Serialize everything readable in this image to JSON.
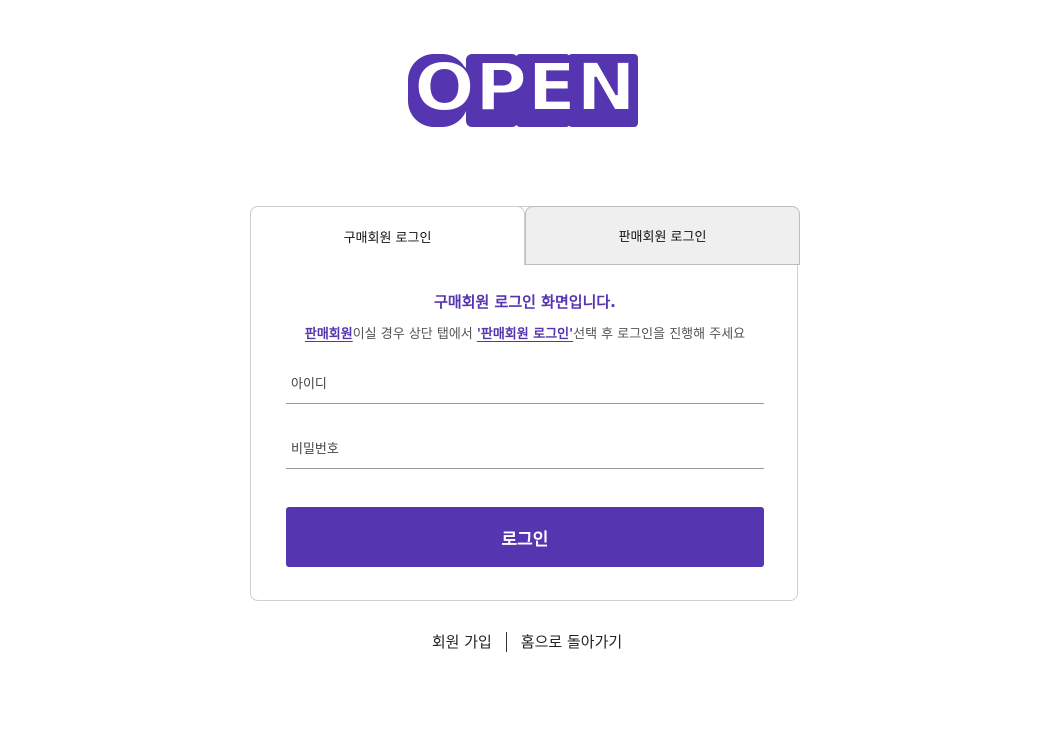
{
  "logo": {
    "text": "OPEN"
  },
  "tabs": [
    {
      "label": "구매회원 로그인",
      "active": true
    },
    {
      "label": "판매회원 로그인",
      "active": false
    }
  ],
  "headline": "구매회원 로그인 화면입니다.",
  "notice": {
    "link1": "판매회원",
    "text1": "이실 경우 상단 탭에서 ",
    "link2": "'판매회원 로그인'",
    "text2": "선택 후 로그인을 진행해 주세요"
  },
  "form": {
    "id_placeholder": "아이디",
    "password_placeholder": "비밀번호",
    "login_label": "로그인"
  },
  "footer": {
    "signup_label": "회원 가입",
    "home_label": "홈으로 돌아가기"
  },
  "colors": {
    "accent": "#5535b0",
    "tab_inactive_bg": "#efefef",
    "border": "#cfcfcf"
  }
}
